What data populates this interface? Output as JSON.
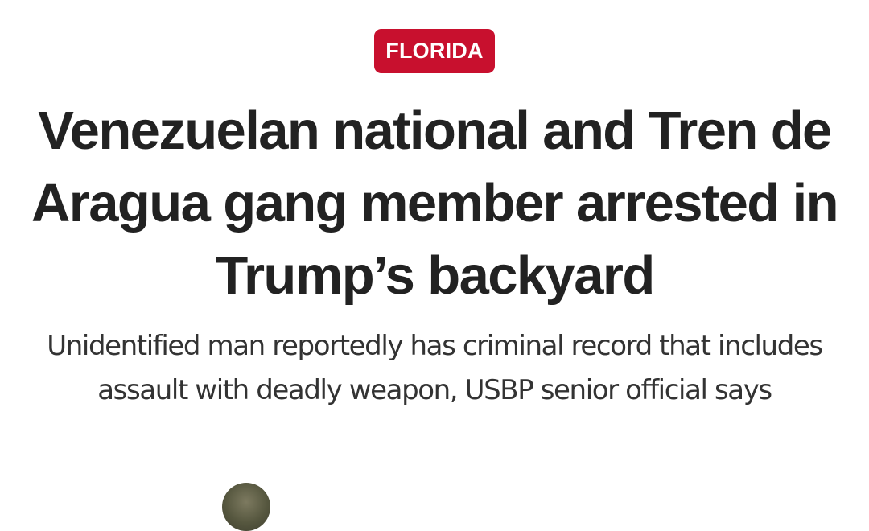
{
  "article": {
    "category": "FLORIDA",
    "headline": "Venezuelan national and Tren de Aragua gang member arrested in Trump’s backyard",
    "subheadline": "Unidentified man reportedly has criminal record that includes assault with deadly weapon, USBP senior official says"
  },
  "colors": {
    "category_background": "#c8102e",
    "category_text": "#ffffff",
    "headline_text": "#222222",
    "subheadline_text": "#333333",
    "page_background": "#ffffff"
  }
}
